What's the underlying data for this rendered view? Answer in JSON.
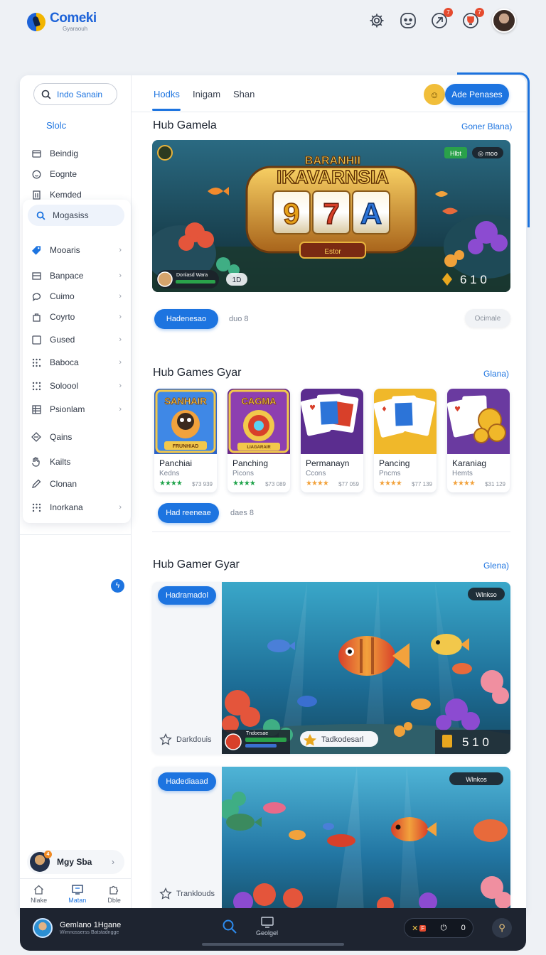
{
  "app": {
    "title": "Comeki",
    "subtitle": "Gyaraouh"
  },
  "topbar": {
    "badge_1": "7",
    "badge_2": "7"
  },
  "sidebar": {
    "search_value": "Indo Sanain",
    "heading": "Slolc",
    "items_top": [
      {
        "label": "Beindig",
        "icon": "grid-icon"
      },
      {
        "label": "Eognte",
        "icon": "smile-icon"
      },
      {
        "label": "Kemded",
        "icon": "building-icon"
      }
    ],
    "sub_search": "Mogasiss",
    "items": [
      {
        "label": "Mooaris",
        "icon": "tag-icon"
      },
      {
        "label": "Banpace",
        "icon": "list-icon"
      },
      {
        "label": "Cuimo",
        "icon": "chat-icon"
      },
      {
        "label": "Coyrto",
        "icon": "bag-icon"
      },
      {
        "label": "Gused",
        "icon": "square-icon"
      },
      {
        "label": "Baboca",
        "icon": "dots-icon"
      },
      {
        "label": "Soloool",
        "icon": "dots-icon"
      },
      {
        "label": "Psionlam",
        "icon": "grid-icon"
      },
      {
        "label": "Qains",
        "icon": "diamond-icon"
      },
      {
        "label": "Kailts",
        "icon": "hand-icon"
      },
      {
        "label": "Clonan",
        "icon": "pen-icon"
      },
      {
        "label": "Inorkana",
        "icon": "dots-icon"
      }
    ],
    "profile_name": "Mgy Sba",
    "profile_badge": "4",
    "tabs": [
      {
        "label": "Nlake"
      },
      {
        "label": "Matan"
      },
      {
        "label": "Dble"
      }
    ]
  },
  "tabs": [
    {
      "label": "Hodks"
    },
    {
      "label": "Inigam"
    },
    {
      "label": "Shan"
    }
  ],
  "header_button": "Ade Penases",
  "section1": {
    "title": "Hub Gamela",
    "link": "Goner Blana)",
    "hero_title_top": "BARANHII",
    "hero_title": "IKAVARNSIA",
    "reels": [
      "9",
      "7",
      "A"
    ],
    "hero_badge_green": "Hlbt",
    "hero_badge_dark": "◎ moo",
    "hero_player": "Donlasd Wara",
    "hero_level": "1D",
    "hero_plaque": "Estor",
    "hero_score": "6 1 0",
    "button": "Hadenesao",
    "meta": "duo 8",
    "ghost": "Ocimale"
  },
  "section2": {
    "title": "Hub Games Gyar",
    "link": "Glana)",
    "games": [
      {
        "thumb_title": "SANHAIR",
        "thumb_caption": "FRUNHIAD",
        "name": "Panchiai",
        "sub": "Kedns",
        "stars": "★★★★",
        "meta": "$73 939"
      },
      {
        "thumb_title": "CAGMA",
        "thumb_caption": "LIAGARAIR",
        "name": "Panching",
        "sub": "Picons",
        "stars": "★★★★",
        "meta": "$73 089"
      },
      {
        "thumb_title": "",
        "thumb_caption": "",
        "name": "Permanayn",
        "sub": "Ccons",
        "stars": "★★★★",
        "meta": "$77 059"
      },
      {
        "thumb_title": "",
        "thumb_caption": "",
        "name": "Pancing",
        "sub": "Pncms",
        "stars": "★★★★",
        "meta": "$77 139"
      },
      {
        "thumb_title": "",
        "thumb_caption": "",
        "name": "Karaniag",
        "sub": "Hemts",
        "stars": "★★★★",
        "meta": "$31 129"
      }
    ],
    "button": "Had reeneae",
    "meta": "daes 8"
  },
  "section3": {
    "title": "Hub Gamer Gyar",
    "link": "Glena)",
    "card1": {
      "button": "Hadramadol",
      "fav": "Darkdouis",
      "tag": "Wlnkso",
      "player": "Tndoesae",
      "chip": "Tadkodesarl",
      "score": "5 1 0"
    },
    "card2": {
      "button": "Hadediaaad",
      "fav": "Tranklouds",
      "tag": "Wlnkos"
    }
  },
  "dock": {
    "name": "Gemlano 1Hgane",
    "sub": "Wimnosserss Batstadngge",
    "mid_label": "Geolgel",
    "ctrl_badge": "F",
    "ctrl_value": "0"
  },
  "colors": {
    "accent": "#1d74e0",
    "gold": "#f1be3a",
    "dark": "#1e2430"
  }
}
